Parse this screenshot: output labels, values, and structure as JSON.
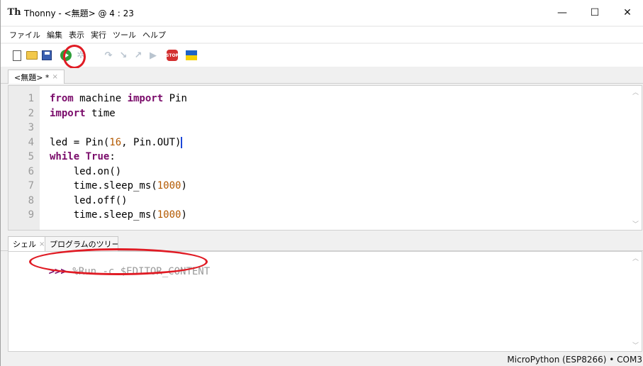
{
  "titlebar": {
    "title": "Thonny  -  <無題>  @  4 : 23",
    "logo_text": "Th",
    "minimize": "—",
    "maximize": "☐",
    "close": "✕"
  },
  "menu": [
    "ファイル",
    "編集",
    "表示",
    "実行",
    "ツール",
    "ヘルプ"
  ],
  "toolbar": {
    "icons": [
      "new-file-icon",
      "open-file-icon",
      "save-icon",
      "run-icon",
      "debug-icon",
      "step-over-icon",
      "step-into-icon",
      "step-out-icon",
      "resume-icon",
      "stop-icon",
      "flag-icon"
    ],
    "stop_label": "STOP"
  },
  "editor": {
    "tab_label": "<無題> *",
    "tab_close": "×",
    "line_numbers": [
      "1",
      "2",
      "3",
      "4",
      "5",
      "6",
      "7",
      "8",
      "9"
    ],
    "lines": [
      {
        "parts": [
          {
            "t": "from",
            "c": "kw"
          },
          {
            "t": " machine ",
            "c": ""
          },
          {
            "t": "import",
            "c": "kw"
          },
          {
            "t": " Pin",
            "c": ""
          }
        ]
      },
      {
        "parts": [
          {
            "t": "import",
            "c": "kw"
          },
          {
            "t": " time",
            "c": ""
          }
        ]
      },
      {
        "parts": []
      },
      {
        "parts": [
          {
            "t": "led = Pin(",
            "c": ""
          },
          {
            "t": "16",
            "c": "num"
          },
          {
            "t": ", Pin.OUT)",
            "c": "cursor"
          }
        ]
      },
      {
        "parts": [
          {
            "t": "while",
            "c": "kw"
          },
          {
            "t": " ",
            "c": ""
          },
          {
            "t": "True",
            "c": "kw"
          },
          {
            "t": ":",
            "c": ""
          }
        ]
      },
      {
        "parts": [
          {
            "t": "    led.on()",
            "c": ""
          }
        ]
      },
      {
        "parts": [
          {
            "t": "    time.sleep_ms(",
            "c": ""
          },
          {
            "t": "1000",
            "c": "num"
          },
          {
            "t": ")",
            "c": ""
          }
        ]
      },
      {
        "parts": [
          {
            "t": "    led.off()",
            "c": ""
          }
        ]
      },
      {
        "parts": [
          {
            "t": "    time.sleep_ms(",
            "c": ""
          },
          {
            "t": "1000",
            "c": "num"
          },
          {
            "t": ")",
            "c": ""
          }
        ]
      }
    ]
  },
  "shell": {
    "tab_label": "シェル",
    "tab_close": "×",
    "other_tab_label": "プログラムのツリー",
    "prompt": ">>>",
    "command": " %Run -c $EDITOR_CONTENT"
  },
  "status": {
    "text": "MicroPython (ESP8266)  •  COM3"
  },
  "colors": {
    "keyword": "#7a0b6a",
    "number": "#b35900",
    "annotation": "#e01b24",
    "run": "#2e9e3a"
  }
}
